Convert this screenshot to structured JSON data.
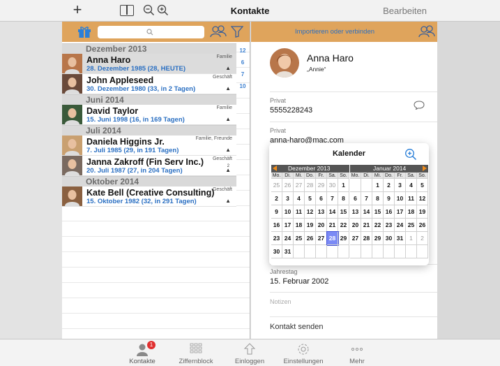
{
  "navbar": {
    "title": "Kontakte",
    "edit_label": "Bearbeiten"
  },
  "left_header": {
    "search_placeholder": ""
  },
  "sections": [
    {
      "title": "Dezember 2013",
      "contacts": [
        {
          "name": "Anna Haro",
          "date": "28. Dezember 1985 (28, HEUTE)",
          "tag": "Familie",
          "selected": true
        },
        {
          "name": "John Appleseed",
          "date": "30. Dezember 1980 (33, in 2 Tagen)",
          "tag": "Geschäft",
          "selected": false
        }
      ]
    },
    {
      "title": "Juni 2014",
      "contacts": [
        {
          "name": "David Taylor",
          "date": "15. Juni 1998 (16, in 169 Tagen)",
          "tag": "Familie",
          "selected": false
        }
      ]
    },
    {
      "title": "Juli 2014",
      "contacts": [
        {
          "name": "Daniela Higgins Jr.",
          "date": "7. Juli 1985 (29, in 191 Tagen)",
          "tag": "Familie, Freunde",
          "selected": false
        },
        {
          "name": "Janna Zakroff (Fin Serv Inc.)",
          "date": "20. Juli 1987 (27, in 204 Tagen)",
          "tag": "Geschäft",
          "selected": false
        }
      ]
    },
    {
      "title": "Oktober 2014",
      "contacts": [
        {
          "name": "Kate Bell (Creative Consulting)",
          "date": "15. Oktober 1982 (32, in 291 Tagen)",
          "tag": "Geschäft",
          "selected": false
        }
      ]
    }
  ],
  "cake_count_2": "2",
  "index_strip": [
    "12",
    "6",
    "7",
    "10"
  ],
  "detail": {
    "import_label": "Importieren oder verbinden",
    "name": "Anna Haro",
    "nickname": "„Annie“",
    "phone_label": "Privat",
    "phone": "5555228243",
    "email_label": "Privat",
    "email": "anna-haro@mac.com",
    "anniversary_label": "Jahrestag",
    "anniversary": "15. Februar 2002",
    "notes_label": "Notizen",
    "send_contact": "Kontakt senden"
  },
  "calendar": {
    "title": "Kalender",
    "month1": "Dezember 2013",
    "month2": "Januar 2014",
    "weekdays": [
      "Mo.",
      "Di.",
      "Mi.",
      "Do.",
      "Fr.",
      "Sa.",
      "So."
    ],
    "month1_days": [
      [
        "25",
        "26",
        "27",
        "28",
        "29",
        "30",
        "1"
      ],
      [
        "2",
        "3",
        "4",
        "5",
        "6",
        "7",
        "8"
      ],
      [
        "9",
        "10",
        "11",
        "12",
        "13",
        "14",
        "15"
      ],
      [
        "16",
        "17",
        "18",
        "19",
        "20",
        "21",
        "22"
      ],
      [
        "23",
        "24",
        "25",
        "26",
        "27",
        "28",
        "29"
      ],
      [
        "30",
        "31",
        "",
        "",
        "",
        "",
        ""
      ]
    ],
    "month2_days": [
      [
        "",
        "",
        "1",
        "2",
        "3",
        "4",
        "5"
      ],
      [
        "6",
        "7",
        "8",
        "9",
        "10",
        "11",
        "12"
      ],
      [
        "13",
        "14",
        "15",
        "16",
        "17",
        "18",
        "19"
      ],
      [
        "20",
        "21",
        "22",
        "23",
        "24",
        "25",
        "26"
      ],
      [
        "27",
        "28",
        "29",
        "30",
        "31",
        "1",
        "2"
      ],
      [
        "",
        "",
        "",
        "",
        "",
        "",
        ""
      ]
    ],
    "today": "28"
  },
  "tabbar": {
    "items": [
      {
        "label": "Kontakte",
        "icon": "person-icon"
      },
      {
        "label": "Ziffernblock",
        "icon": "keypad-icon"
      },
      {
        "label": "Einloggen",
        "icon": "upload-icon"
      },
      {
        "label": "Einstellungen",
        "icon": "gear-icon"
      },
      {
        "label": "Mehr",
        "icon": "more-icon"
      }
    ],
    "badge": "1"
  }
}
